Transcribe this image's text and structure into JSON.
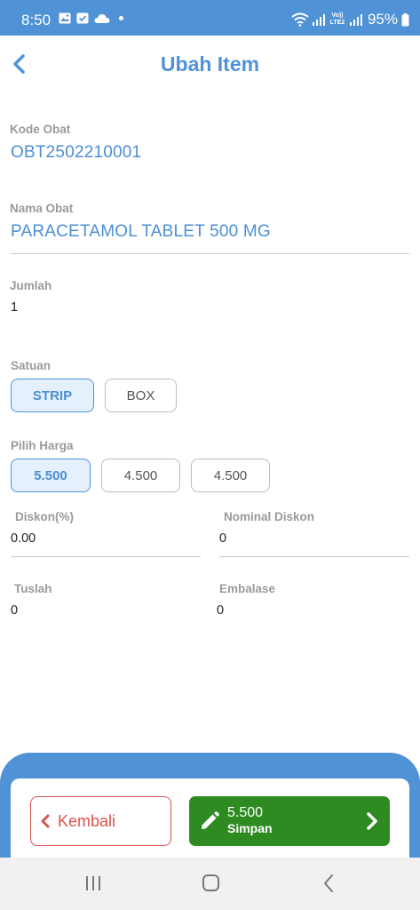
{
  "status_bar": {
    "time": "8:50",
    "battery": "95%",
    "network_label": "Vo)) LTE2",
    "icons": [
      "image-icon",
      "check-square-icon",
      "cloud-icon",
      "dot-icon",
      "wifi-icon",
      "signal-icon",
      "battery-icon"
    ]
  },
  "header": {
    "title": "Ubah Item",
    "back_icon": "chevron-left-icon"
  },
  "fields": {
    "kode_obat": {
      "label": "Kode Obat",
      "value": "OBT2502210001"
    },
    "nama_obat": {
      "label": "Nama Obat",
      "value": "PARACETAMOL TABLET 500 MG"
    },
    "jumlah": {
      "label": "Jumlah",
      "value": "1"
    },
    "satuan": {
      "label": "Satuan",
      "options": [
        "STRIP",
        "BOX"
      ],
      "selected": "STRIP"
    },
    "pilih_harga": {
      "label": "Pilih Harga",
      "options": [
        "5.500",
        "4.500",
        "4.500"
      ],
      "selected": "5.500"
    },
    "diskon_persen": {
      "label": "Diskon(%)",
      "value": "0.00"
    },
    "nominal_diskon": {
      "label": "Nominal Diskon",
      "value": "0"
    },
    "tuslah": {
      "label": "Tuslah",
      "value": "0"
    },
    "embalase": {
      "label": "Embalase",
      "value": "0"
    }
  },
  "actions": {
    "back_label": "Kembali",
    "save_amount": "5.500",
    "save_label": "Simpan"
  },
  "colors": {
    "primary": "#4f92d6",
    "selected_bg": "#e4f0fb",
    "danger": "#d9534f",
    "success": "#2e8b22"
  }
}
